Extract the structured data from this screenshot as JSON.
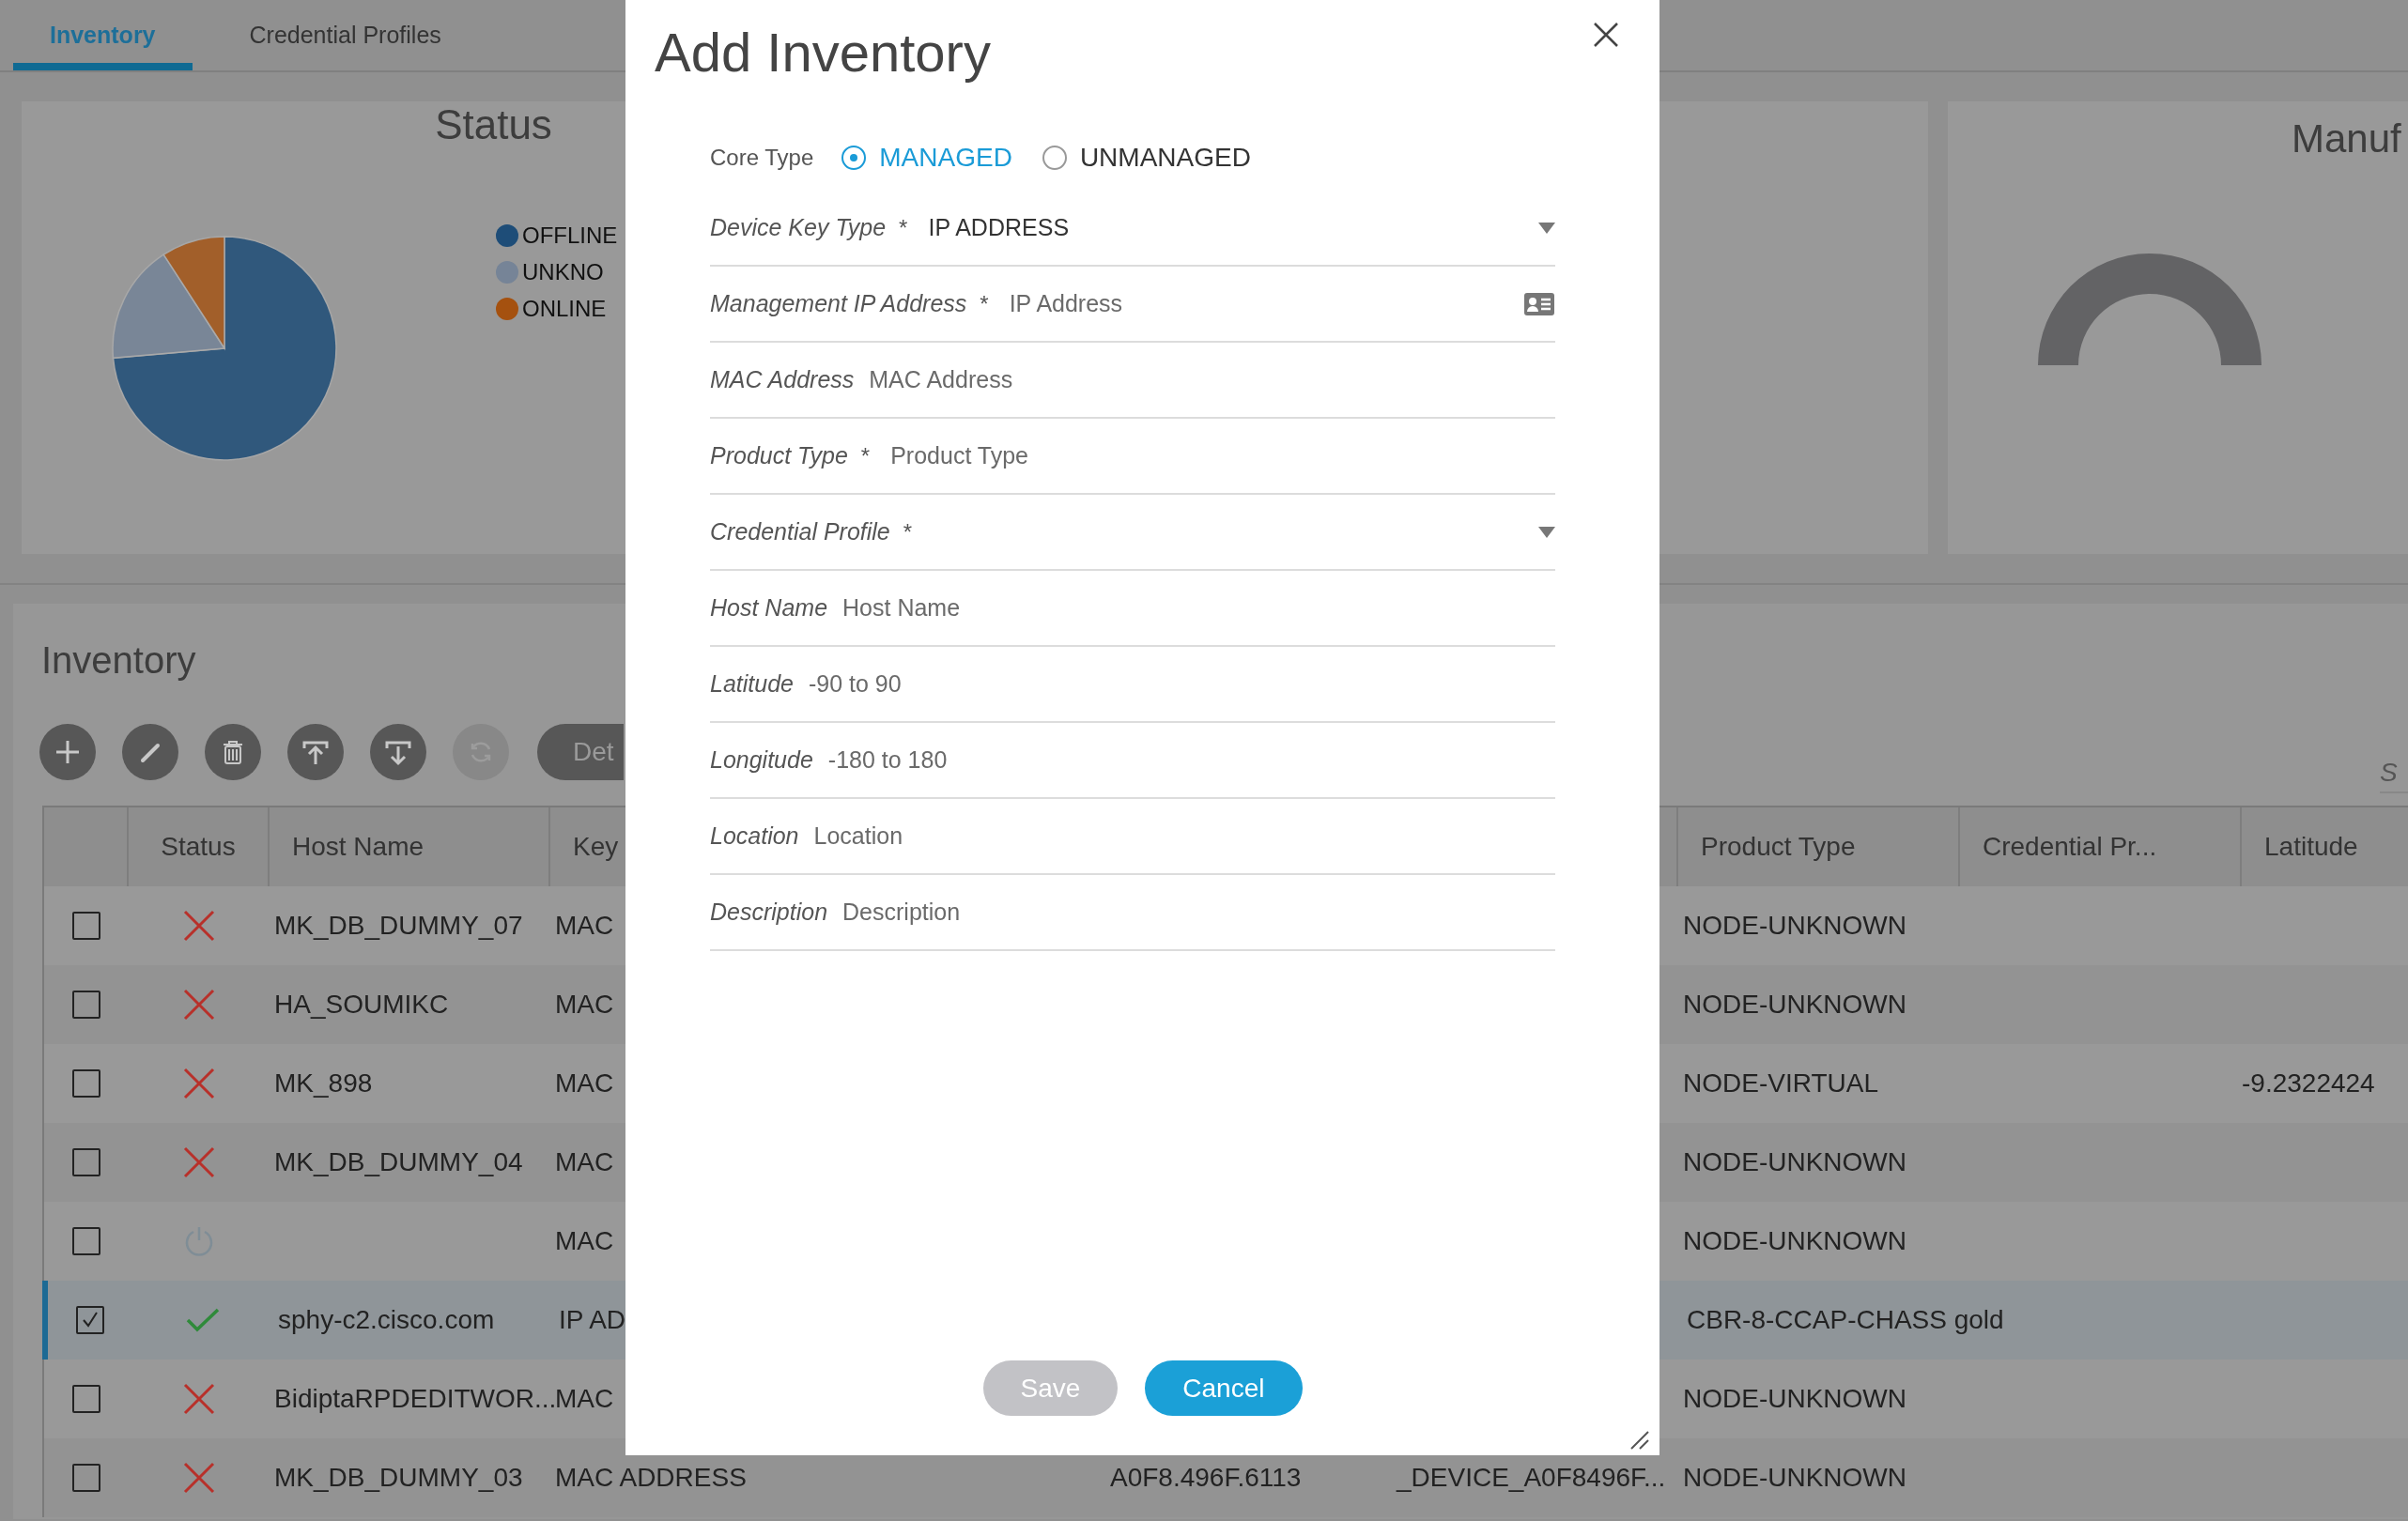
{
  "tabs": [
    {
      "label": "Inventory",
      "selected": true
    },
    {
      "label": "Credential Profiles",
      "selected": false
    }
  ],
  "status_card": {
    "title": "Status",
    "legend": [
      {
        "label": "OFFLINE",
        "color": "#1e4d78"
      },
      {
        "label": "UNKNO",
        "color": "#768497"
      },
      {
        "label": "ONLINE",
        "color": "#a5510f"
      }
    ]
  },
  "manufacturer_card": {
    "title": "Manuf"
  },
  "inventory": {
    "title": "Inventory",
    "toolbar": [
      {
        "kind": "add",
        "disabled": false
      },
      {
        "kind": "edit",
        "disabled": false
      },
      {
        "kind": "delete",
        "disabled": false
      },
      {
        "kind": "upload",
        "disabled": false
      },
      {
        "kind": "download",
        "disabled": false
      },
      {
        "kind": "refresh",
        "disabled": true
      }
    ],
    "details_button": "Det",
    "search": {
      "placeholder": "S"
    },
    "table": {
      "columns": {
        "status": "Status",
        "host_name": "Host Name",
        "key_type": "Key",
        "product_type": "Product Type",
        "credential_profile": "Credential Pr...",
        "latitude": "Latitude"
      },
      "rows": [
        {
          "checked": false,
          "selected": false,
          "kind": "offline",
          "host_name": "MK_DB_DUMMY_07",
          "key_type": "MAC",
          "product_type": "NODE-UNKNOWN"
        },
        {
          "checked": false,
          "selected": false,
          "kind": "offline",
          "host_name": "HA_SOUMIKC",
          "key_type": "MAC",
          "product_type": "NODE-UNKNOWN"
        },
        {
          "checked": false,
          "selected": false,
          "kind": "offline",
          "host_name": "MK_898",
          "key_type": "MAC",
          "product_type": "NODE-VIRTUAL",
          "latitude": "-9.2322424"
        },
        {
          "checked": false,
          "selected": false,
          "kind": "offline",
          "host_name": "MK_DB_DUMMY_04",
          "key_type": "MAC",
          "product_type": "NODE-UNKNOWN"
        },
        {
          "checked": false,
          "selected": false,
          "kind": "unknown",
          "key_type": "MAC",
          "product_type": "NODE-UNKNOWN"
        },
        {
          "checked": true,
          "selected": true,
          "kind": "online",
          "host_name": "sphy-c2.cisco.com",
          "key_type": "IP AD",
          "product_type": "CBR-8-CCAP-CHASS gold"
        },
        {
          "checked": false,
          "selected": false,
          "kind": "offline",
          "host_name": "BidiptaRPDEDITWOR...",
          "key_type": "MAC",
          "product_type": "NODE-UNKNOWN"
        },
        {
          "checked": false,
          "selected": false,
          "kind": "offline",
          "host_name": "MK_DB_DUMMY_03",
          "key_type": "MAC ADDRESS",
          "mac_address": "A0F8.496F.6113",
          "column_6": "_DEVICE_A0F8496F...",
          "product_type": "NODE-UNKNOWN"
        }
      ]
    }
  },
  "modal": {
    "title": "Add Inventory",
    "core_type": {
      "label": "Core Type",
      "options": [
        {
          "label": "MANAGED",
          "selected": true
        },
        {
          "label": "UNMANAGED",
          "selected": false
        }
      ]
    },
    "fields": [
      {
        "kind": "dropdown",
        "label": "Device Key Type",
        "required_mark": "*",
        "value": "IP ADDRESS"
      },
      {
        "kind": "id_text",
        "label": "Management IP Address",
        "required_mark": "*",
        "placeholder": "IP Address"
      },
      {
        "kind": "text",
        "label": "MAC Address",
        "placeholder": "MAC Address"
      },
      {
        "kind": "text",
        "label": "Product Type",
        "required_mark": "*",
        "placeholder": "Product Type"
      },
      {
        "kind": "dropdown",
        "label": "Credential Profile",
        "required_mark": "*"
      },
      {
        "kind": "text",
        "label": "Host Name",
        "placeholder": "Host Name"
      },
      {
        "kind": "text",
        "label": "Latitude",
        "placeholder": "-90 to 90"
      },
      {
        "kind": "text",
        "label": "Longitude",
        "placeholder": "-180 to 180"
      },
      {
        "kind": "text",
        "label": "Location",
        "placeholder": "Location"
      },
      {
        "kind": "text",
        "label": "Description",
        "placeholder": "Description"
      }
    ],
    "buttons": [
      {
        "label": "Save",
        "kind": "secondary",
        "disabled": true
      },
      {
        "label": "Cancel",
        "kind": "primary",
        "disabled": false
      }
    ]
  }
}
